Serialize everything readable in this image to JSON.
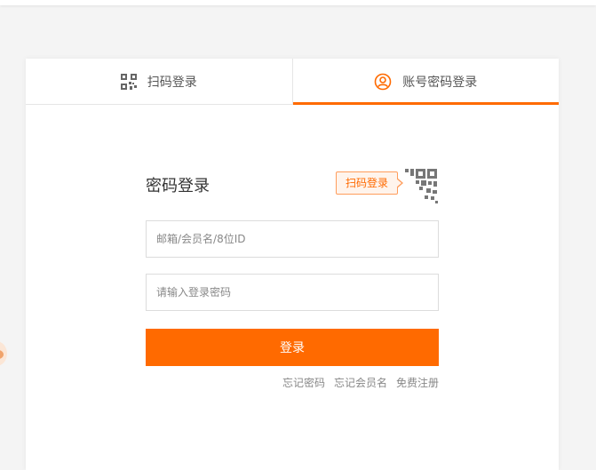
{
  "tabs": {
    "qr_login": "扫码登录",
    "account_login": "账号密码登录"
  },
  "form": {
    "title": "密码登录",
    "qr_tip": "扫码登录",
    "account_placeholder": "邮箱/会员名/8位ID",
    "password_placeholder": "请输入登录密码",
    "submit_label": "登录"
  },
  "links": {
    "forgot_password": "忘记密码",
    "forgot_username": "忘记会员名",
    "register": "免费注册"
  },
  "colors": {
    "accent": "#ff6a00",
    "icon_gray": "#666666"
  },
  "icons": {
    "qr": "qr-code-icon",
    "user": "user-circle-icon",
    "qr_corner": "qr-corner-icon"
  }
}
